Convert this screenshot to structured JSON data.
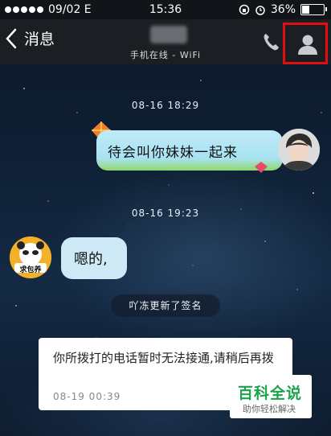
{
  "status_bar": {
    "carrier_mark": "09/02 E",
    "time": "15:36",
    "battery_percent_text": "36%",
    "battery_level": 0.36
  },
  "nav": {
    "back_label": "消息",
    "subtitle": "手机在线 - WiFi"
  },
  "messages": {
    "timestamp_1": "08-16 18:29",
    "outgoing_text": "待会叫你妹妹一起来",
    "timestamp_2": "08-16 19:23",
    "incoming_text": "嗯的,",
    "incoming_avatar_label": "求包养",
    "system_notice": "吖冻更新了签名",
    "card_text": "你所拨打的电话暂时无法接通,请稍后再拨",
    "card_time": "08-19 00:39"
  },
  "watermark": {
    "title": "百科全说",
    "subtitle": "助你轻松解决"
  },
  "colors": {
    "nav_bg": "#1b1e22",
    "highlight_border": "#e01010",
    "bubble_out": "#a8e2f2",
    "bubble_in": "#cfeaf7",
    "watermark_green": "#1aa34a"
  }
}
